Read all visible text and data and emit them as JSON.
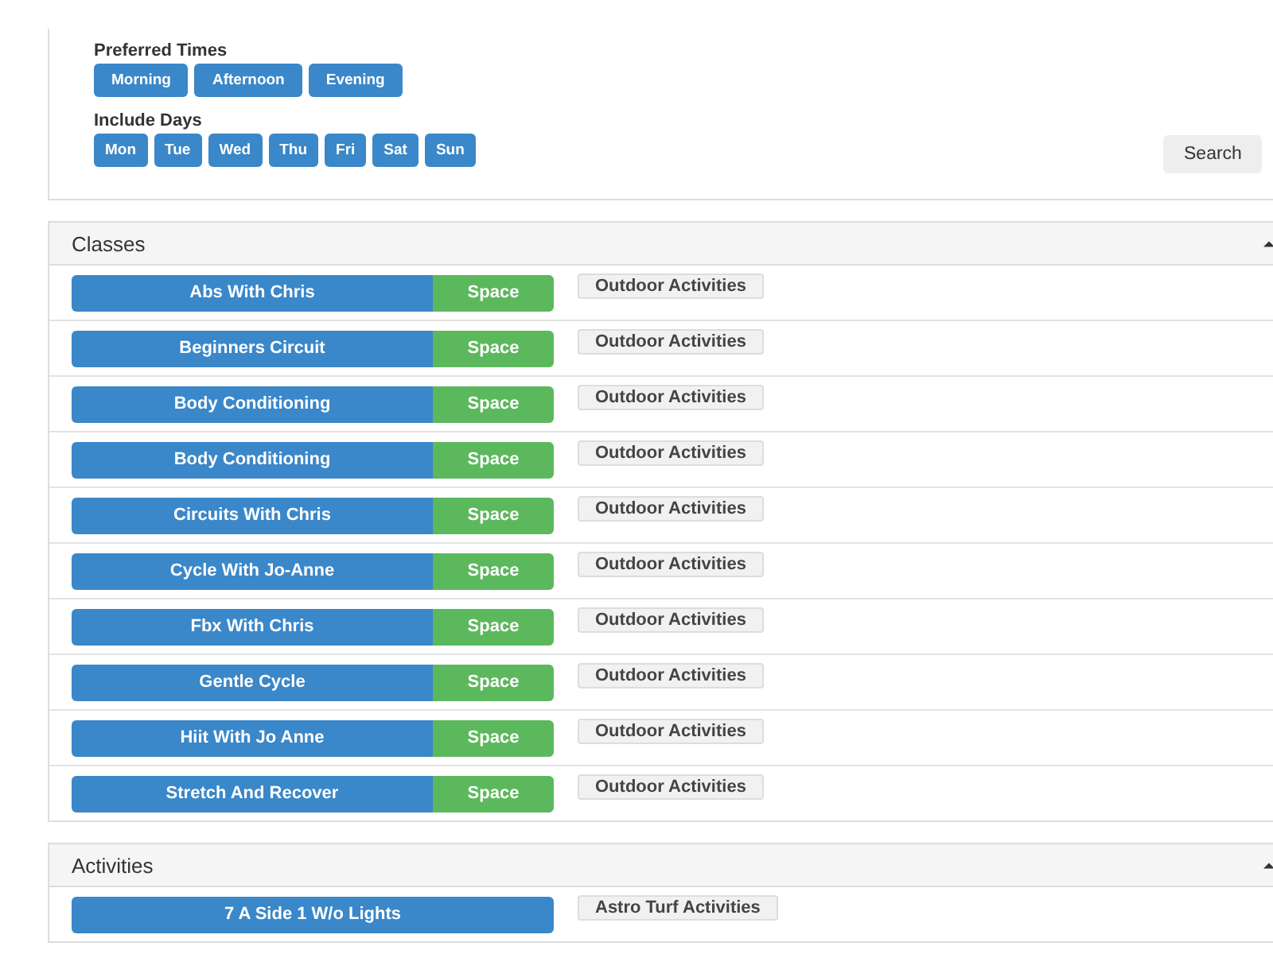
{
  "filters": {
    "times_label": "Preferred Times",
    "times": [
      "Morning",
      "Afternoon",
      "Evening"
    ],
    "days_label": "Include Days",
    "days": [
      "Mon",
      "Tue",
      "Wed",
      "Thu",
      "Fri",
      "Sat",
      "Sun"
    ],
    "search_button": "Search"
  },
  "sections": [
    {
      "title": "Classes",
      "expanded": true,
      "rows": [
        {
          "name": "Abs With Chris",
          "availability": "Space",
          "category": "Outdoor Activities"
        },
        {
          "name": "Beginners Circuit",
          "availability": "Space",
          "category": "Outdoor Activities"
        },
        {
          "name": "Body Conditioning",
          "availability": "Space",
          "category": "Outdoor Activities"
        },
        {
          "name": "Body Conditioning",
          "availability": "Space",
          "category": "Outdoor Activities"
        },
        {
          "name": "Circuits With Chris",
          "availability": "Space",
          "category": "Outdoor Activities"
        },
        {
          "name": "Cycle With Jo-Anne",
          "availability": "Space",
          "category": "Outdoor Activities"
        },
        {
          "name": "Fbx With Chris",
          "availability": "Space",
          "category": "Outdoor Activities"
        },
        {
          "name": "Gentle Cycle",
          "availability": "Space",
          "category": "Outdoor Activities"
        },
        {
          "name": "Hiit With Jo Anne",
          "availability": "Space",
          "category": "Outdoor Activities"
        },
        {
          "name": "Stretch And Recover",
          "availability": "Space",
          "category": "Outdoor Activities"
        }
      ]
    },
    {
      "title": "Activities",
      "expanded": true,
      "rows": [
        {
          "name": "7 A Side 1 W/o Lights",
          "category": "Astro Turf Activities"
        }
      ]
    }
  ]
}
